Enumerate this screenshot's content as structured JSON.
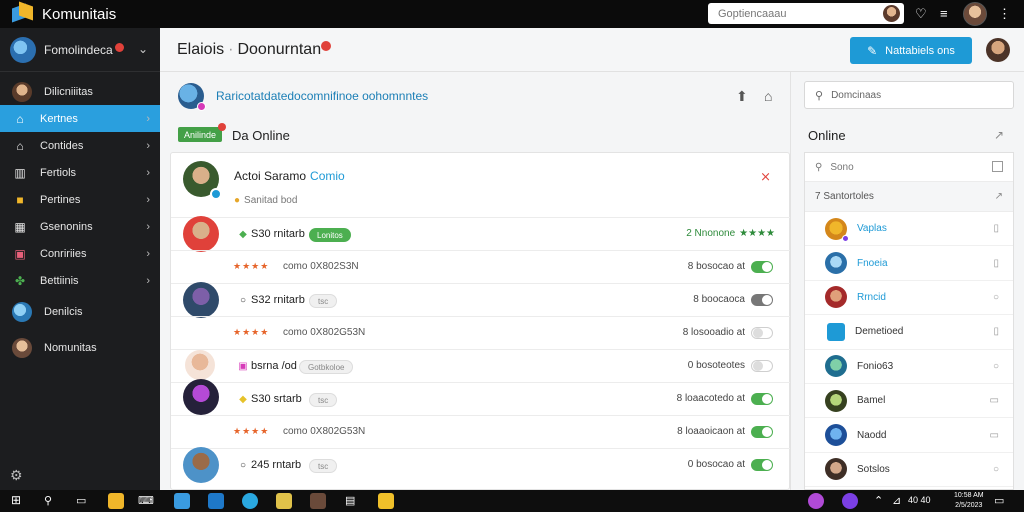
{
  "window": {
    "app_title": "Komunitais",
    "search_placeholder": "Goptiencaaau"
  },
  "sidebar": {
    "header_label": "Fomolindeca",
    "items": [
      {
        "label": "Dilicniiitas",
        "icon": "avatar-icon",
        "active": false,
        "arrow": false
      },
      {
        "label": "Kertnes",
        "icon": "home-icon",
        "active": true,
        "arrow": true
      },
      {
        "label": "Contides",
        "icon": "home-icon",
        "active": false,
        "arrow": true
      },
      {
        "label": "Fertiols",
        "icon": "building-icon",
        "active": false,
        "arrow": true
      },
      {
        "label": "Pertines",
        "icon": "folder-icon",
        "active": false,
        "arrow": true
      },
      {
        "label": "Gsenonins",
        "icon": "grid-icon",
        "active": false,
        "arrow": true
      },
      {
        "label": "Conririies",
        "icon": "bag-icon",
        "active": false,
        "arrow": true
      },
      {
        "label": "Bettiinis",
        "icon": "leaf-icon",
        "active": false,
        "arrow": true
      },
      {
        "label": "Denilcis",
        "icon": "globe-icon",
        "active": false,
        "arrow": false
      },
      {
        "label": "Nomunitas",
        "icon": "avatar-icon",
        "active": false,
        "arrow": false
      }
    ]
  },
  "header": {
    "title": "Elaiois",
    "subtitle": "Doonurntan",
    "button_label": "Nattabiels ons"
  },
  "main": {
    "community_name": "Raricotatdatedocomnifinoe oohomnntes",
    "online_badge": "Anilinde",
    "online_title": "Da Online",
    "first_member": {
      "name": "Actoi Saramo",
      "tag": "Comio",
      "sub": "Sanitad bod"
    },
    "rows": [
      {
        "type": "member",
        "name": "S30 rnitarb",
        "pill": "Lonitos",
        "pill_style": "green",
        "right": "Nnonone",
        "right_prefix": "2",
        "stars": "★★★★",
        "toggle": null
      },
      {
        "type": "code",
        "stars": "★★★★",
        "code": "como 0X802S3N",
        "right": "8 bosocao at",
        "toggle": "on"
      },
      {
        "type": "member",
        "name": "S32 rnitarb",
        "pill": "tsc",
        "pill_style": "grey",
        "right": "8 boocaoca",
        "toggle": "dark"
      },
      {
        "type": "code",
        "stars": "★★★★",
        "code": "como 0X802G53N",
        "right": "8 losooadio at",
        "toggle": "off"
      },
      {
        "type": "member",
        "name": "bsrna /od",
        "pill": "Gotbkoloe",
        "pill_style": "grey",
        "right": "0 bosoteotes",
        "toggle": "off"
      },
      {
        "type": "member",
        "name": "S30 srtarb",
        "pill": "tsc",
        "pill_style": "grey",
        "right": "8 loaacotedo at",
        "toggle": "on"
      },
      {
        "type": "code",
        "stars": "★★★★",
        "code": "como 0X802G53N",
        "right": "8 loaaoicaon at",
        "toggle": "on"
      },
      {
        "type": "member",
        "name": "245 rntarb",
        "pill": "tsc",
        "pill_style": "grey",
        "right": "0 bosocao at",
        "toggle": "on"
      }
    ]
  },
  "right_panel": {
    "search_placeholder": "Domcinaas",
    "online_title": "Online",
    "filter_placeholder": "Sono",
    "group_label": "7 Santortoles",
    "members": [
      {
        "name": "Vaplas",
        "color": "#1e9ad6"
      },
      {
        "name": "Fnoeia",
        "color": "#1e9ad6"
      },
      {
        "name": "Rrncid",
        "color": "#1e9ad6"
      },
      {
        "name": "Demetioed",
        "color": "#333333"
      },
      {
        "name": "Fonio63",
        "color": "#333333"
      },
      {
        "name": "Bamel",
        "color": "#333333"
      },
      {
        "name": "Naodd",
        "color": "#333333"
      },
      {
        "name": "Sotslos",
        "color": "#333333"
      }
    ]
  },
  "taskbar": {
    "clock_line1": "10:58 AM",
    "clock_line2": "2/5/2023",
    "tray_text": "40 40"
  },
  "colors": {
    "accent": "#1e9ad6",
    "sidebar_bg": "#1c1d1f",
    "online_green": "#4caf50",
    "alert_red": "#e0413a"
  }
}
